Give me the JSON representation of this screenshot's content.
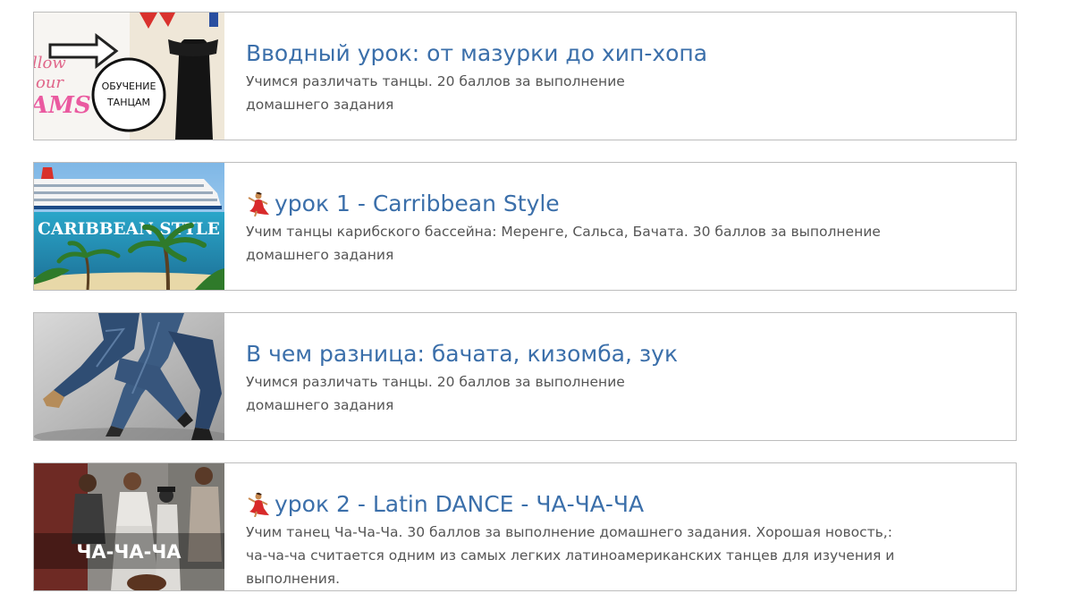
{
  "lessons": [
    {
      "title": "Вводный урок: от мазурки до хип-хопа",
      "has_emoji": false,
      "description": "Учимся различать танцы. 20 баллов за выполнение домашнего задания",
      "thumbnail": {
        "icon": "dance-lesson-collage-image",
        "circle_text_line1": "ОБУЧЕНИЕ",
        "circle_text_line2": "ТАНЦАМ",
        "script_text_lines": [
          "llow",
          "our",
          "AMS"
        ]
      }
    },
    {
      "title": "урок 1 - Carribbean Style",
      "has_emoji": true,
      "emoji": "💃",
      "description": "Учим танцы карибского бассейна: Меренге, Сальса, Бачата. 30 баллов за выполнение домашнего задания",
      "thumbnail": {
        "icon": "cruise-ship-beach-image",
        "overlay_text": "CARIBBEAN STYLE"
      }
    },
    {
      "title": "В чем разница: бачата, кизомба, зук",
      "has_emoji": false,
      "description": "Учимся различать танцы. 20 баллов за выполнение домашнего задания",
      "thumbnail": {
        "icon": "dancers-legs-jeans-image"
      }
    },
    {
      "title": "урок 2 - Latin DANCE - ЧА-ЧА-ЧА",
      "has_emoji": true,
      "emoji": "💃",
      "description": "Учим танец Ча-Ча-Ча. 30 баллов за выполнение домашнего задания. Хорошая новость,: ча-ча-ча считается одним из самых легких латиноамериканских танцев для изучения и выполнения.",
      "thumbnail": {
        "icon": "street-dancers-photo-image",
        "overlay_text": "ЧА-ЧА-ЧА"
      }
    }
  ],
  "colors": {
    "title": "#3b6faa",
    "description": "#555555",
    "border": "#bdbdbd"
  }
}
